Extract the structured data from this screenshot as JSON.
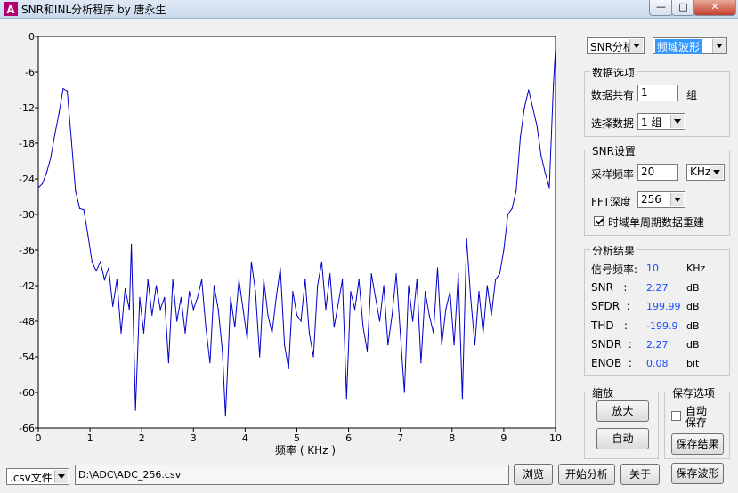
{
  "window": {
    "title": "SNR和INL分析程序 by 唐永生",
    "icon": "app-icon"
  },
  "chart_data": {
    "type": "line",
    "xlabel": "频率 ( KHz )",
    "ylabel": "",
    "xlim": [
      0,
      10
    ],
    "ylim": [
      -66,
      0
    ],
    "xticks": [
      "0",
      "1",
      "2",
      "3",
      "4",
      "5",
      "6",
      "7",
      "8",
      "9",
      "10"
    ],
    "yticks": [
      "0",
      "-6",
      "-12",
      "-18",
      "-24",
      "-30",
      "-36",
      "-42",
      "-48",
      "-54",
      "-60",
      "-66"
    ],
    "grid": false,
    "series": [
      {
        "color": "#0000c8",
        "x": [
          0,
          0.08,
          0.16,
          0.24,
          0.32,
          0.4,
          0.48,
          0.56,
          0.64,
          0.72,
          0.8,
          0.88,
          0.96,
          1.04,
          1.12,
          1.2,
          1.28,
          1.36,
          1.44,
          1.52,
          1.6,
          1.68,
          1.76,
          1.8,
          1.88,
          1.96,
          2.04,
          2.12,
          2.2,
          2.28,
          2.36,
          2.44,
          2.52,
          2.6,
          2.68,
          2.76,
          2.84,
          2.92,
          3.0,
          3.08,
          3.16,
          3.24,
          3.32,
          3.4,
          3.48,
          3.56,
          3.62,
          3.72,
          3.8,
          3.88,
          3.96,
          4.04,
          4.12,
          4.2,
          4.28,
          4.36,
          4.44,
          4.52,
          4.6,
          4.68,
          4.76,
          4.84,
          4.92,
          5.0,
          5.08,
          5.16,
          5.24,
          5.32,
          5.4,
          5.48,
          5.56,
          5.64,
          5.72,
          5.8,
          5.88,
          5.96,
          6.04,
          6.12,
          6.2,
          6.28,
          6.36,
          6.44,
          6.52,
          6.6,
          6.68,
          6.76,
          6.84,
          6.92,
          7.0,
          7.08,
          7.16,
          7.24,
          7.32,
          7.4,
          7.48,
          7.56,
          7.64,
          7.72,
          7.8,
          7.88,
          7.96,
          8.04,
          8.12,
          8.2,
          8.28,
          8.36,
          8.44,
          8.52,
          8.6,
          8.68,
          8.76,
          8.84,
          8.92,
          9.0,
          9.08,
          9.16,
          9.24,
          9.32,
          9.4,
          9.48,
          9.56,
          9.64,
          9.72,
          9.8,
          9.88,
          9.96,
          10.0
        ],
        "y": [
          -25.5,
          -24.8,
          -23,
          -20.5,
          -16.5,
          -13,
          -8.8,
          -9.2,
          -17.5,
          -26,
          -29,
          -29.2,
          -33.5,
          -38,
          -39.5,
          -38,
          -41,
          -39,
          -45.5,
          -41,
          -50,
          -42.5,
          -46,
          -35,
          -63,
          -44,
          -50,
          -41,
          -47,
          -42,
          -46,
          -44,
          -55,
          -41,
          -48,
          -44,
          -50,
          -43,
          -46,
          -44,
          -41,
          -49,
          -55,
          -42,
          -46,
          -53,
          -64,
          -44,
          -49,
          -41,
          -46,
          -51,
          -38,
          -43,
          -54,
          -41,
          -47,
          -50,
          -44,
          -39,
          -52,
          -56,
          -43,
          -47,
          -48,
          -41,
          -50,
          -54,
          -42,
          -38,
          -46,
          -40,
          -49,
          -45,
          -41,
          -61,
          -43,
          -46,
          -41,
          -49,
          -53,
          -40,
          -44,
          -48,
          -42,
          -52,
          -47,
          -40,
          -50,
          -60,
          -42,
          -48,
          -41,
          -55,
          -43,
          -47,
          -50,
          -39,
          -52,
          -46,
          -43,
          -52,
          -40,
          -61,
          -34,
          -44,
          -52,
          -43,
          -50,
          -42,
          -47,
          -41,
          -40,
          -36,
          -30,
          -29,
          -26,
          -17,
          -12,
          -9,
          -12,
          -15,
          -20,
          -23,
          -25.5,
          -8,
          -2
        ]
      }
    ]
  },
  "controls": {
    "mode_select": "SNR分析",
    "view_select": "频域波形",
    "data_group": {
      "title": "数据选项",
      "total_label": "数据共有",
      "total_value": "1",
      "total_unit": "组",
      "select_label": "选择数据",
      "select_value": "1 组"
    },
    "snr_group": {
      "title": "SNR设置",
      "rate_label": "采样频率",
      "rate_value": "20",
      "rate_unit": "KHz",
      "fft_label": "FFT深度",
      "fft_value": "256",
      "rebuild_label": "时域单周期数据重建",
      "rebuild_checked": true
    },
    "results": {
      "title": "分析结果",
      "rows": [
        {
          "label": "信号频率:",
          "value": "10",
          "unit": "KHz"
        },
        {
          "label": "SNR   :",
          "value": "2.27",
          "unit": "dB"
        },
        {
          "label": "SFDR  :",
          "value": "199.99",
          "unit": "dB"
        },
        {
          "label": "THD   :",
          "value": "-199.9",
          "unit": "dB"
        },
        {
          "label": "SNDR  :",
          "value": "2.27",
          "unit": "dB"
        },
        {
          "label": "ENOB  :",
          "value": "0.08",
          "unit": "bit"
        }
      ]
    },
    "zoom_group": {
      "title": "缩放",
      "zoom_in": "放大",
      "auto": "自动"
    },
    "save_group": {
      "title": "保存选项",
      "auto_save": "自动\n保存",
      "save_result": "保存结果"
    },
    "save_wave": "保存波形"
  },
  "bottom": {
    "file_type": ".csv文件",
    "file_path": "D:\\ADC\\ADC_256.csv",
    "browse": "浏览",
    "start": "开始分析",
    "about": "关于"
  }
}
